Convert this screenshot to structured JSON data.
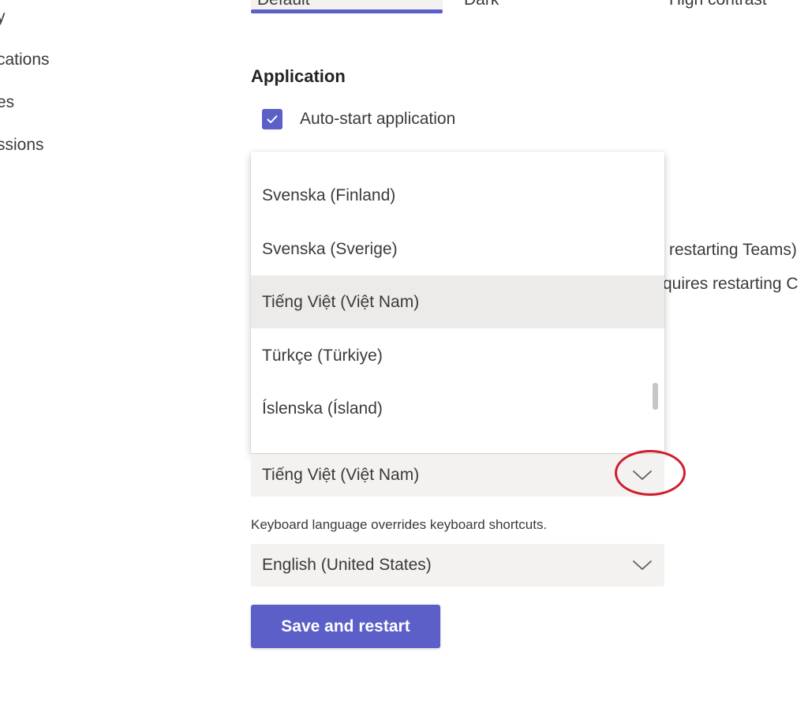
{
  "sidebar": {
    "items": [
      {
        "label": "y"
      },
      {
        "label": "cations"
      },
      {
        "label": "es"
      },
      {
        "label": "ssions"
      }
    ]
  },
  "theme": {
    "options": [
      {
        "label": "Default"
      },
      {
        "label": "Dark"
      },
      {
        "label": "High contrast"
      }
    ]
  },
  "application": {
    "heading": "Application",
    "auto_start_label": "Auto-start application",
    "auto_start_checked": true
  },
  "partially_hidden": {
    "line1": "restarting Teams)",
    "line2": "quires restarting C"
  },
  "language_dropdown": {
    "options": [
      {
        "label": "Svenska (Finland)"
      },
      {
        "label": "Svenska (Sverige)"
      },
      {
        "label": "Tiếng Việt (Việt Nam)",
        "selected": true
      },
      {
        "label": "Türkçe (Türkiye)"
      },
      {
        "label": "Íslenska (Ísland)"
      }
    ],
    "value": "Tiếng Việt (Việt Nam)"
  },
  "keyboard": {
    "helper": "Keyboard language overrides keyboard shortcuts.",
    "value": "English (United States)"
  },
  "actions": {
    "save_label": "Save and restart"
  },
  "colors": {
    "accent": "#5b5fc7",
    "annotation": "#d01c2b"
  },
  "icons": {
    "checkbox": "checkmark-icon",
    "select": "chevron-down-icon"
  }
}
